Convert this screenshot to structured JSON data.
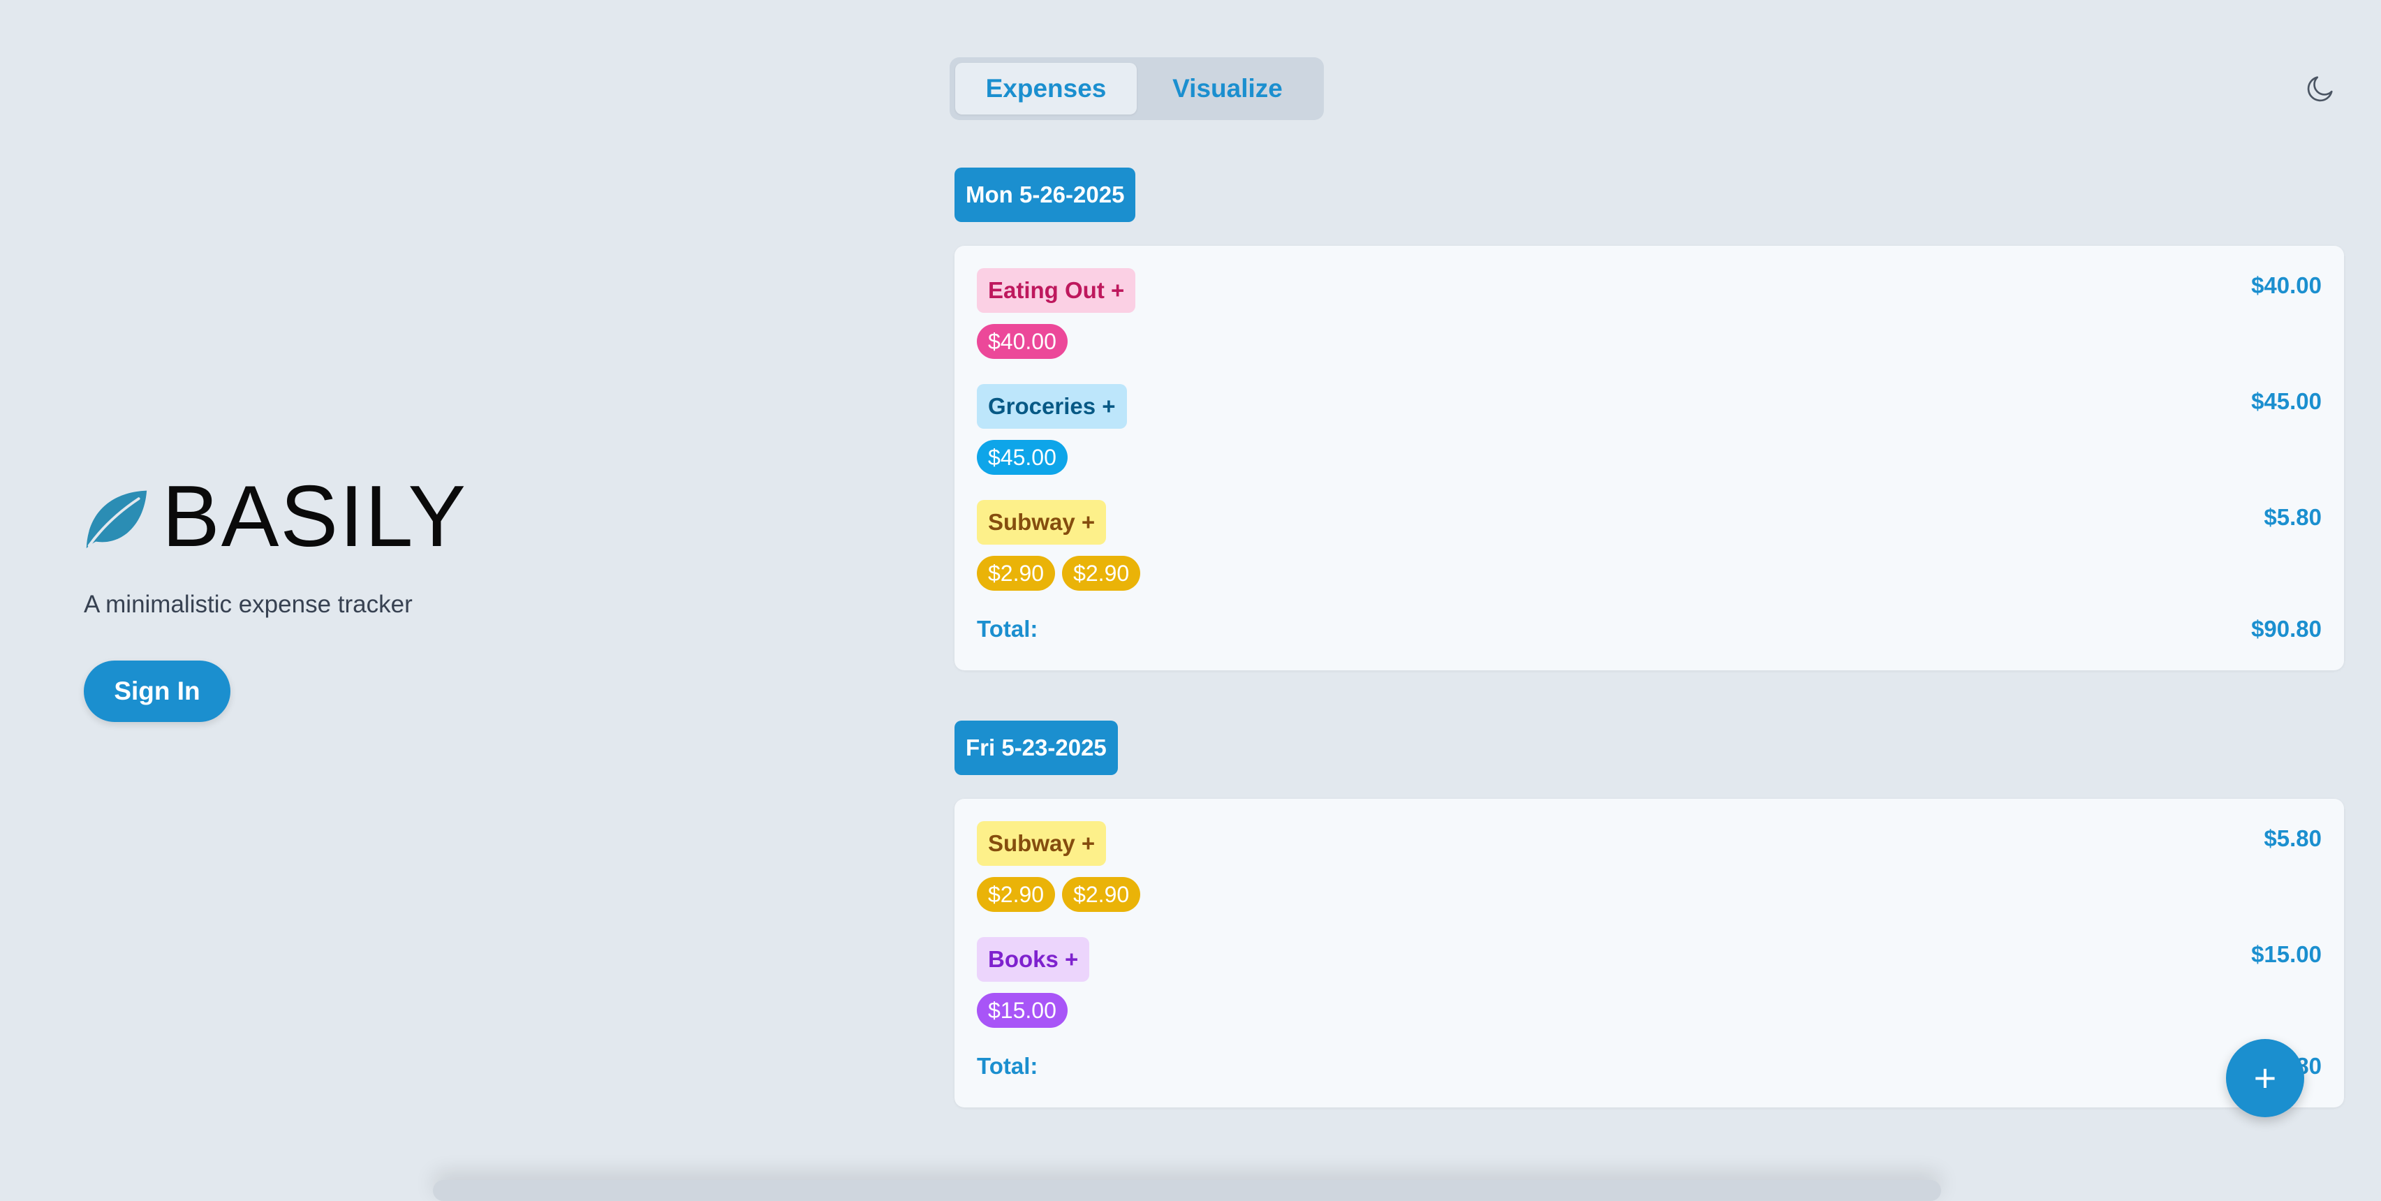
{
  "app": {
    "name": "BASILY",
    "tagline": "A minimalistic expense tracker",
    "signin_label": "Sign In",
    "accent_color": "#1b8fcf",
    "logo_icon": "leaf-icon"
  },
  "tabs": [
    {
      "label": "Expenses",
      "active": true
    },
    {
      "label": "Visualize",
      "active": false
    }
  ],
  "theme_toggle_icon": "moon-icon",
  "total_label": "Total:",
  "fab_label": "+",
  "days": [
    {
      "date": "Mon 5-26-2025",
      "categories": [
        {
          "label": "Eating Out +",
          "total": "$40.00",
          "entries": [
            "$40.00"
          ],
          "color": "#ec4899"
        },
        {
          "label": "Groceries +",
          "total": "$45.00",
          "entries": [
            "$45.00"
          ],
          "color": "#0ea5e9"
        },
        {
          "label": "Subway +",
          "total": "$5.80",
          "entries": [
            "$2.90",
            "$2.90"
          ],
          "color": "#eab308"
        }
      ],
      "total": "$90.80"
    },
    {
      "date": "Fri 5-23-2025",
      "categories": [
        {
          "label": "Subway +",
          "total": "$5.80",
          "entries": [
            "$2.90",
            "$2.90"
          ],
          "color": "#eab308"
        },
        {
          "label": "Books +",
          "total": "$15.00",
          "entries": [
            "$15.00"
          ],
          "color": "#a855f7"
        }
      ],
      "total": "$20.80"
    }
  ]
}
